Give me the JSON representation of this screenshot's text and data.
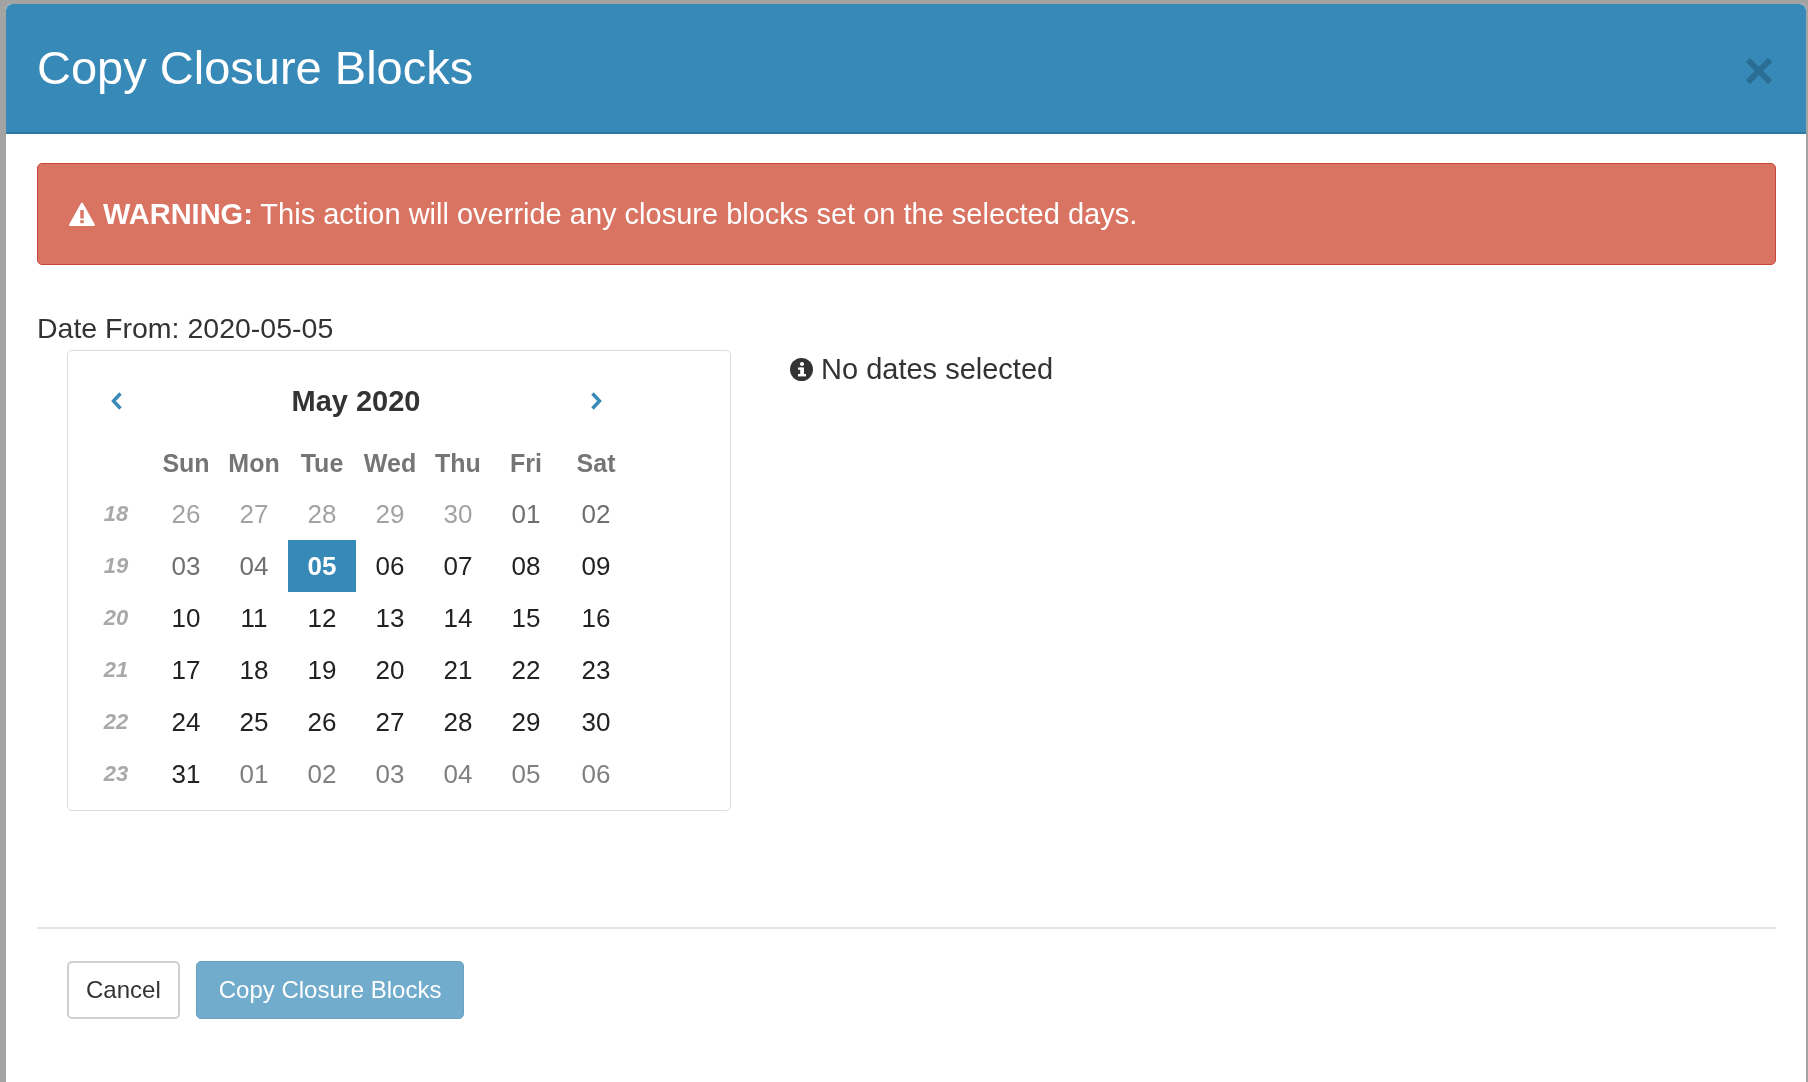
{
  "dialog": {
    "title": "Copy Closure Blocks"
  },
  "warning": {
    "message": "**WARNING:** This action will override any closure blocks set on the selected days."
  },
  "date_from": "Date From: 2020-05-05",
  "calendar": {
    "month": "May 2020",
    "weekdays": [
      "Sun",
      "Mon",
      "Tue",
      "Wed",
      "Thu",
      "Fri",
      "Sat"
    ],
    "weeks": [
      {
        "number": "18",
        "days": [
          {
            "label": "26",
            "other_month": true,
            "disabled": true,
            "selected": false
          },
          {
            "label": "27",
            "other_month": true,
            "disabled": true,
            "selected": false
          },
          {
            "label": "28",
            "other_month": true,
            "disabled": true,
            "selected": false
          },
          {
            "label": "29",
            "other_month": true,
            "disabled": true,
            "selected": false
          },
          {
            "label": "30",
            "other_month": true,
            "disabled": true,
            "selected": false
          },
          {
            "label": "01",
            "other_month": false,
            "disabled": true,
            "selected": false
          },
          {
            "label": "02",
            "other_month": false,
            "disabled": true,
            "selected": false
          }
        ]
      },
      {
        "number": "19",
        "days": [
          {
            "label": "03",
            "other_month": false,
            "disabled": true,
            "selected": false
          },
          {
            "label": "04",
            "other_month": false,
            "disabled": true,
            "selected": false
          },
          {
            "label": "05",
            "other_month": false,
            "disabled": false,
            "selected": true
          },
          {
            "label": "06",
            "other_month": false,
            "disabled": false,
            "selected": false
          },
          {
            "label": "07",
            "other_month": false,
            "disabled": false,
            "selected": false
          },
          {
            "label": "08",
            "other_month": false,
            "disabled": false,
            "selected": false
          },
          {
            "label": "09",
            "other_month": false,
            "disabled": false,
            "selected": false
          }
        ]
      },
      {
        "number": "20",
        "days": [
          {
            "label": "10",
            "other_month": false,
            "disabled": false,
            "selected": false
          },
          {
            "label": "11",
            "other_month": false,
            "disabled": false,
            "selected": false
          },
          {
            "label": "12",
            "other_month": false,
            "disabled": false,
            "selected": false
          },
          {
            "label": "13",
            "other_month": false,
            "disabled": false,
            "selected": false
          },
          {
            "label": "14",
            "other_month": false,
            "disabled": false,
            "selected": false
          },
          {
            "label": "15",
            "other_month": false,
            "disabled": false,
            "selected": false
          },
          {
            "label": "16",
            "other_month": false,
            "disabled": false,
            "selected": false
          }
        ]
      },
      {
        "number": "21",
        "days": [
          {
            "label": "17",
            "other_month": false,
            "disabled": false,
            "selected": false
          },
          {
            "label": "18",
            "other_month": false,
            "disabled": false,
            "selected": false
          },
          {
            "label": "19",
            "other_month": false,
            "disabled": false,
            "selected": false
          },
          {
            "label": "20",
            "other_month": false,
            "disabled": false,
            "selected": false
          },
          {
            "label": "21",
            "other_month": false,
            "disabled": false,
            "selected": false
          },
          {
            "label": "22",
            "other_month": false,
            "disabled": false,
            "selected": false
          },
          {
            "label": "23",
            "other_month": false,
            "disabled": false,
            "selected": false
          }
        ]
      },
      {
        "number": "22",
        "days": [
          {
            "label": "24",
            "other_month": false,
            "disabled": false,
            "selected": false
          },
          {
            "label": "25",
            "other_month": false,
            "disabled": false,
            "selected": false
          },
          {
            "label": "26",
            "other_month": false,
            "disabled": false,
            "selected": false
          },
          {
            "label": "27",
            "other_month": false,
            "disabled": false,
            "selected": false
          },
          {
            "label": "28",
            "other_month": false,
            "disabled": false,
            "selected": false
          },
          {
            "label": "29",
            "other_month": false,
            "disabled": false,
            "selected": false
          },
          {
            "label": "30",
            "other_month": false,
            "disabled": false,
            "selected": false
          }
        ]
      },
      {
        "number": "23",
        "days": [
          {
            "label": "31",
            "other_month": false,
            "disabled": false,
            "selected": false
          },
          {
            "label": "01",
            "other_month": true,
            "disabled": false,
            "selected": false
          },
          {
            "label": "02",
            "other_month": true,
            "disabled": false,
            "selected": false
          },
          {
            "label": "03",
            "other_month": true,
            "disabled": false,
            "selected": false
          },
          {
            "label": "04",
            "other_month": true,
            "disabled": false,
            "selected": false
          },
          {
            "label": "05",
            "other_month": true,
            "disabled": false,
            "selected": false
          },
          {
            "label": "06",
            "other_month": true,
            "disabled": false,
            "selected": false
          }
        ]
      }
    ]
  },
  "selection_info": "No dates selected",
  "buttons": [
    {
      "kind": "cancel",
      "label": "Cancel",
      "disabled": false
    },
    {
      "kind": "submit",
      "label": "Copy Closure Blocks",
      "disabled": true
    }
  ]
}
